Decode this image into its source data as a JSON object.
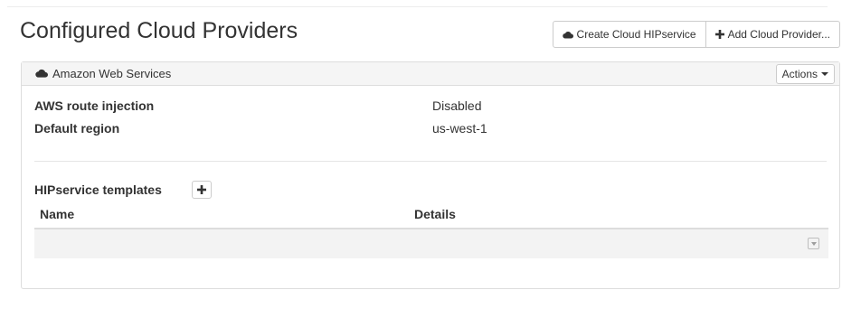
{
  "page": {
    "title": "Configured Cloud Providers"
  },
  "header_actions": {
    "create_label": "Create Cloud HIPservice",
    "create_icon": "cloud-icon",
    "add_label": "Add Cloud Provider...",
    "add_icon": "plus-icon"
  },
  "provider": {
    "name": "Amazon Web Services",
    "icon": "cloud-icon",
    "actions_label": "Actions",
    "settings": [
      {
        "label": "AWS route injection",
        "value": "Disabled"
      },
      {
        "label": "Default region",
        "value": "us-west-1"
      }
    ],
    "templates": {
      "label": "HIPservice templates",
      "add_icon": "plus-icon",
      "columns": [
        "Name",
        "Details"
      ],
      "rows": []
    }
  }
}
